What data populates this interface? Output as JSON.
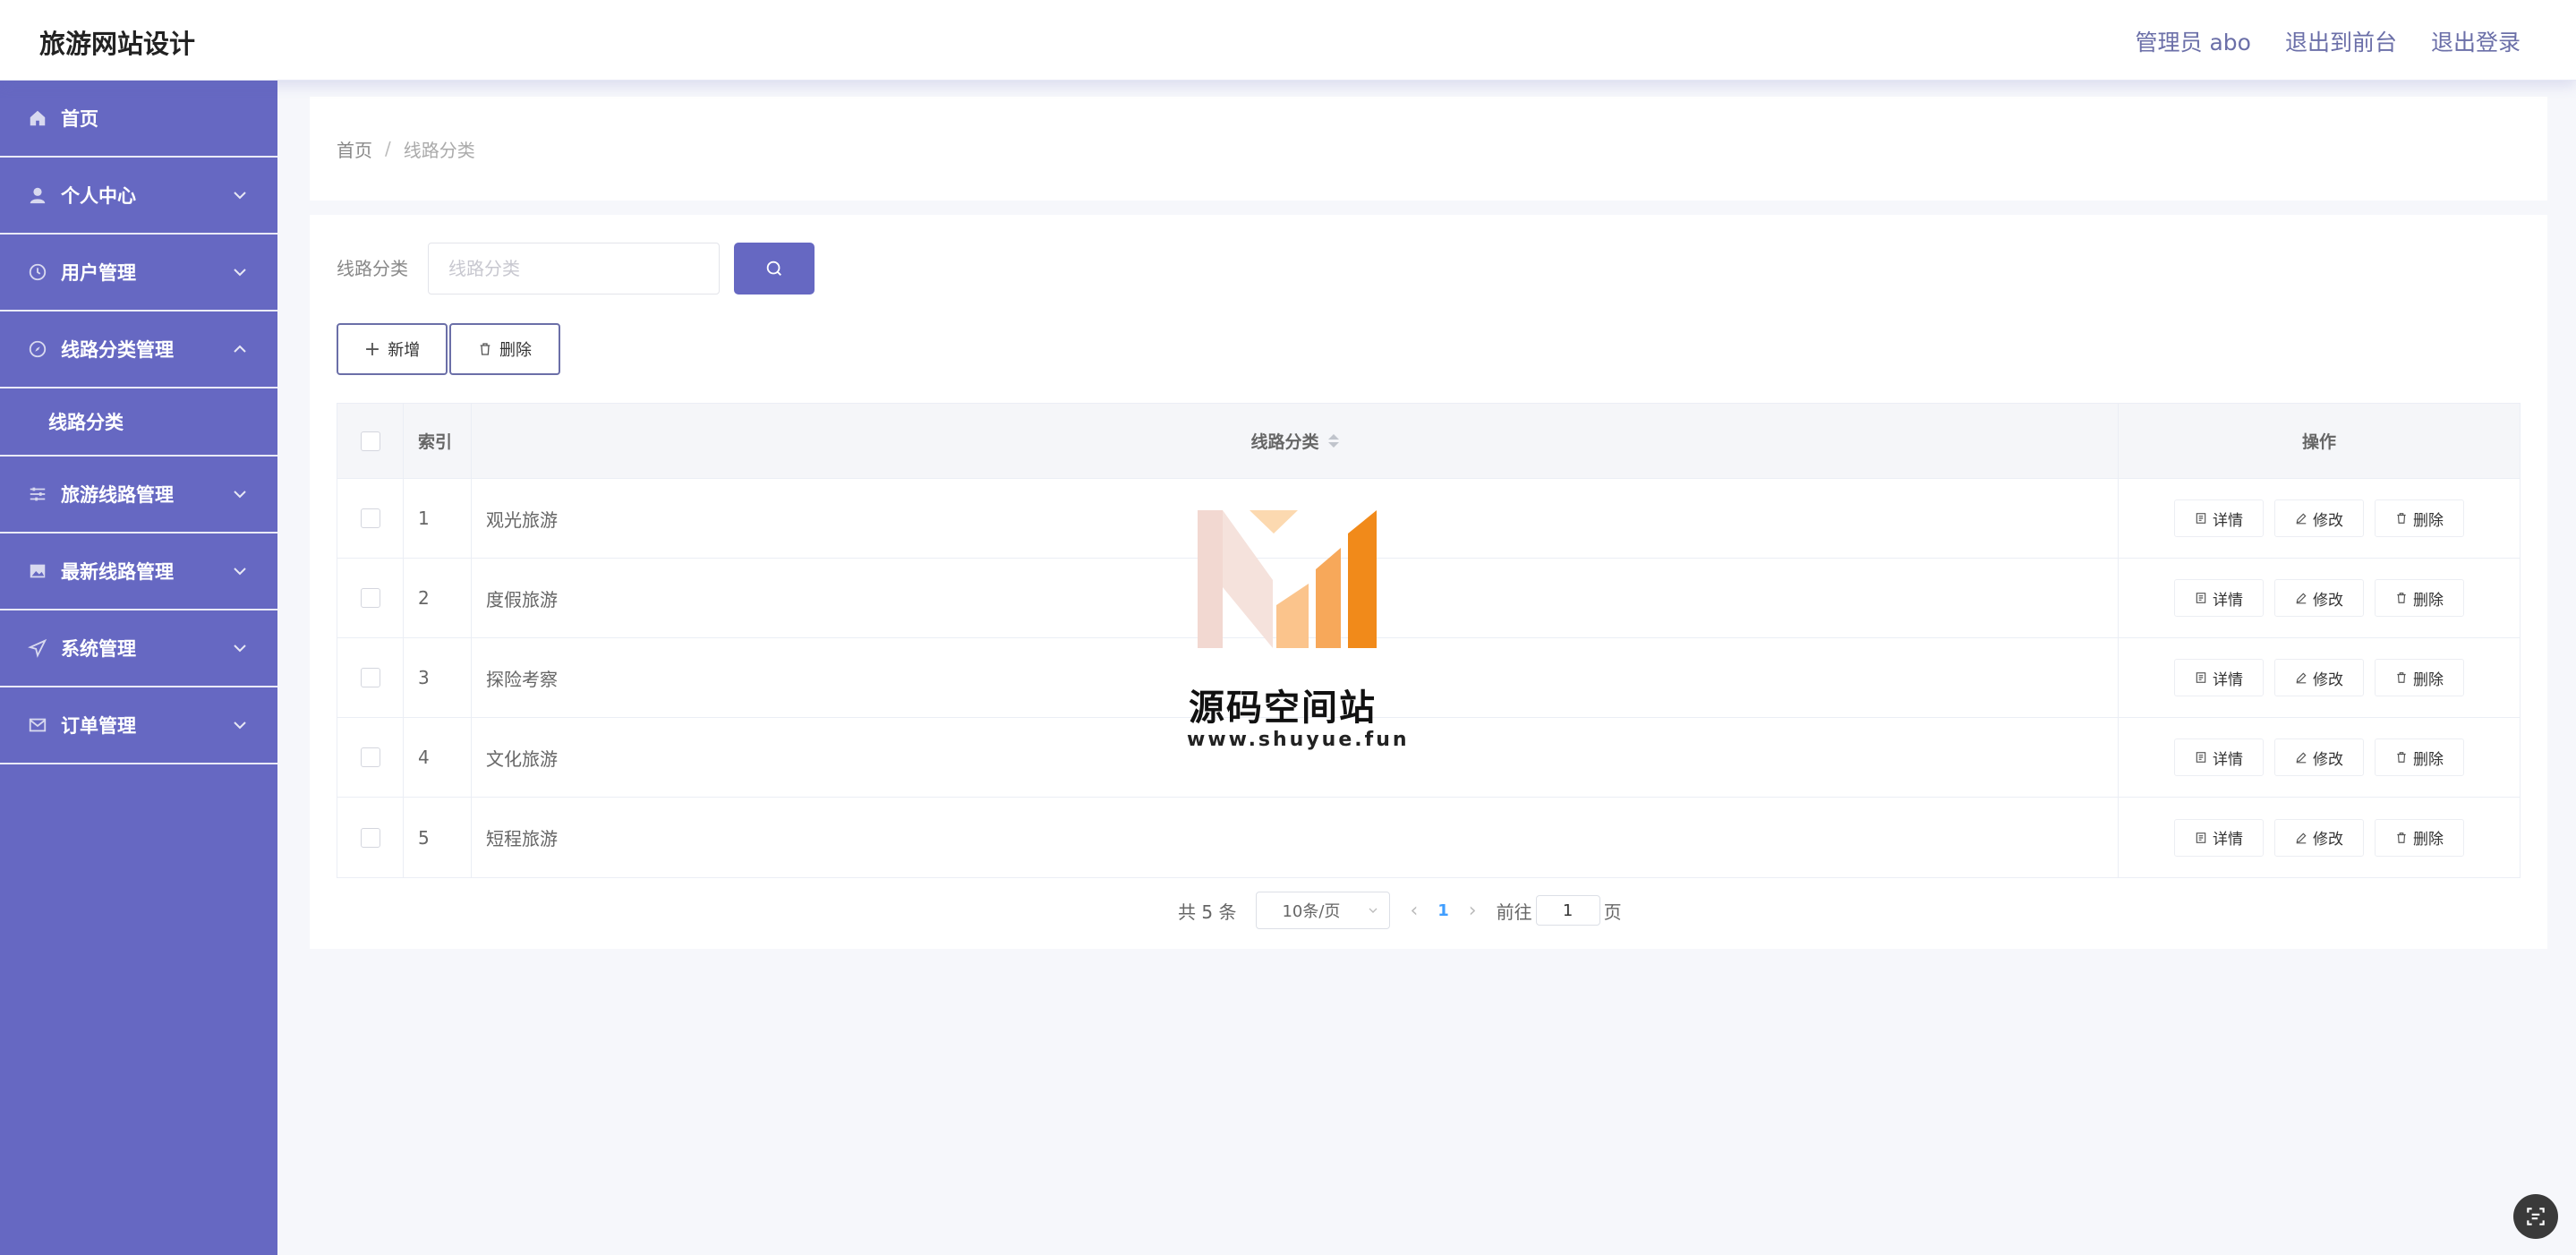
{
  "header": {
    "brand": "旅游网站设计",
    "admin_label": "管理员 abo",
    "exit_front_label": "退出到前台",
    "logout_label": "退出登录"
  },
  "sidebar": {
    "items": [
      {
        "label": "首页",
        "icon": "home-icon"
      },
      {
        "label": "个人中心",
        "icon": "user-icon"
      },
      {
        "label": "用户管理",
        "icon": "clock-icon"
      },
      {
        "label": "线路分类管理",
        "icon": "compass-icon"
      },
      {
        "label": "线路分类",
        "icon": ""
      },
      {
        "label": "旅游线路管理",
        "icon": "sliders-icon"
      },
      {
        "label": "最新线路管理",
        "icon": "image-icon"
      },
      {
        "label": "系统管理",
        "icon": "send-icon"
      },
      {
        "label": "订单管理",
        "icon": "mail-icon"
      }
    ]
  },
  "breadcrumb": {
    "home": "首页",
    "separator": "/",
    "current": "线路分类"
  },
  "search": {
    "label": "线路分类",
    "placeholder": "线路分类"
  },
  "toolbar": {
    "add_label": "新增",
    "delete_label": "删除"
  },
  "table": {
    "columns": [
      "索引",
      "线路分类",
      "操作"
    ],
    "rows": [
      {
        "index": "1",
        "name": "观光旅游"
      },
      {
        "index": "2",
        "name": "度假旅游"
      },
      {
        "index": "3",
        "name": "探险考察"
      },
      {
        "index": "4",
        "name": "文化旅游"
      },
      {
        "index": "5",
        "name": "短程旅游"
      }
    ],
    "actions": {
      "detail": "详情",
      "edit": "修改",
      "delete": "删除"
    }
  },
  "pagination": {
    "total": "共 5 条",
    "page_size": "10条/页",
    "current_page": "1",
    "goto_label": "前往",
    "goto_value": "1",
    "page_suffix": "页"
  },
  "watermark": {
    "name": "源码空间站",
    "url": "www.shuyue.fun"
  },
  "colors": {
    "primary": "#6668c2",
    "sidebar_bg": "#6668c2",
    "link_blue": "#409eff"
  }
}
